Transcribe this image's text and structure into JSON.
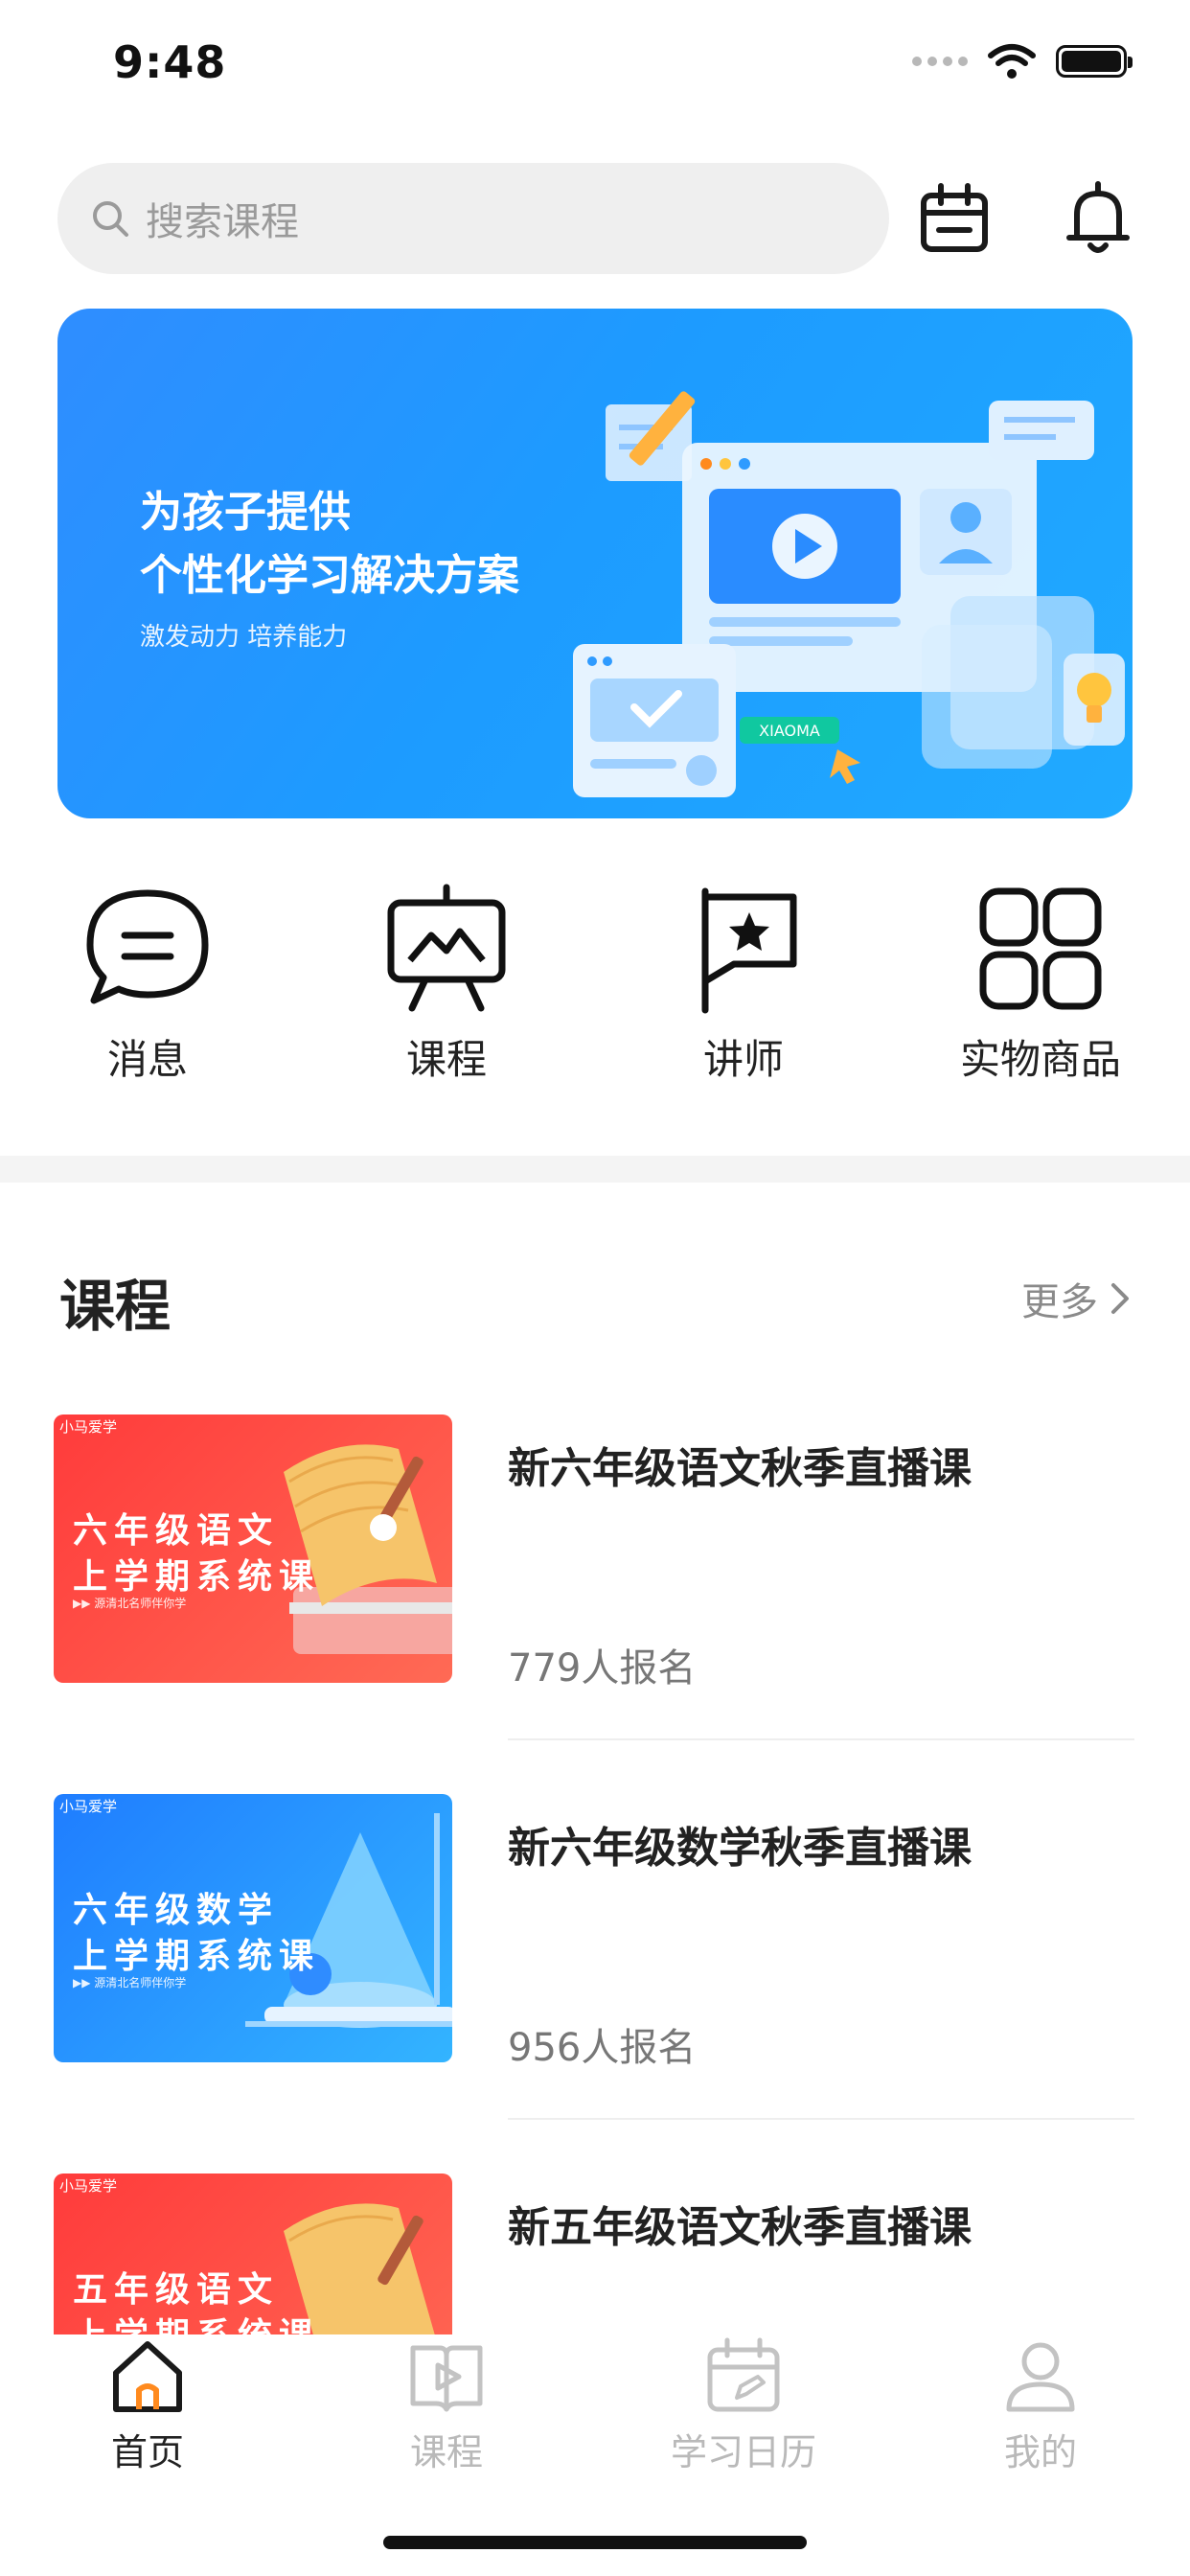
{
  "status_bar": {
    "time": "9:48"
  },
  "search": {
    "placeholder": "搜索课程"
  },
  "banner": {
    "title_line1": "为孩子提供",
    "title_line2": "个性化学习解决方案",
    "subtitle": "激发动力 培养能力",
    "art_tag": "XIAOMA"
  },
  "quick_nav": [
    {
      "label": "消息",
      "icon": "chat-icon"
    },
    {
      "label": "课程",
      "icon": "presentation-board-icon"
    },
    {
      "label": "讲师",
      "icon": "star-flag-icon"
    },
    {
      "label": "实物商品",
      "icon": "four-squares-icon"
    }
  ],
  "section": {
    "title": "课程",
    "more_label": "更多"
  },
  "courses": [
    {
      "title": "新六年级语文秋季直播课",
      "count": "779人报名",
      "thumb": {
        "brand": "小马爱学",
        "line1": "六年级语文",
        "line2": "上学期系统课",
        "tag": "▶▶ 源清北名师伴你学",
        "theme": "red"
      }
    },
    {
      "title": "新六年级数学秋季直播课",
      "count": "956人报名",
      "thumb": {
        "brand": "小马爱学",
        "line1": "六年级数学",
        "line2": "上学期系统课",
        "tag": "▶▶ 源清北名师伴你学",
        "theme": "blue"
      }
    },
    {
      "title": "新五年级语文秋季直播课",
      "count": "",
      "thumb": {
        "brand": "小马爱学",
        "line1": "五年级语文",
        "line2": "上学期系统课",
        "tag": "",
        "theme": "red"
      }
    }
  ],
  "tab_bar": [
    {
      "label": "首页",
      "icon": "home-icon",
      "active": true
    },
    {
      "label": "课程",
      "icon": "video-book-icon",
      "active": false
    },
    {
      "label": "学习日历",
      "icon": "calendar-edit-icon",
      "active": false
    },
    {
      "label": "我的",
      "icon": "person-icon",
      "active": false
    }
  ],
  "colors": {
    "accent_orange": "#ff8a1e",
    "banner_blue": "#1d9bff",
    "thumb_red": "#ff4a45",
    "thumb_blue": "#1f8cff"
  }
}
